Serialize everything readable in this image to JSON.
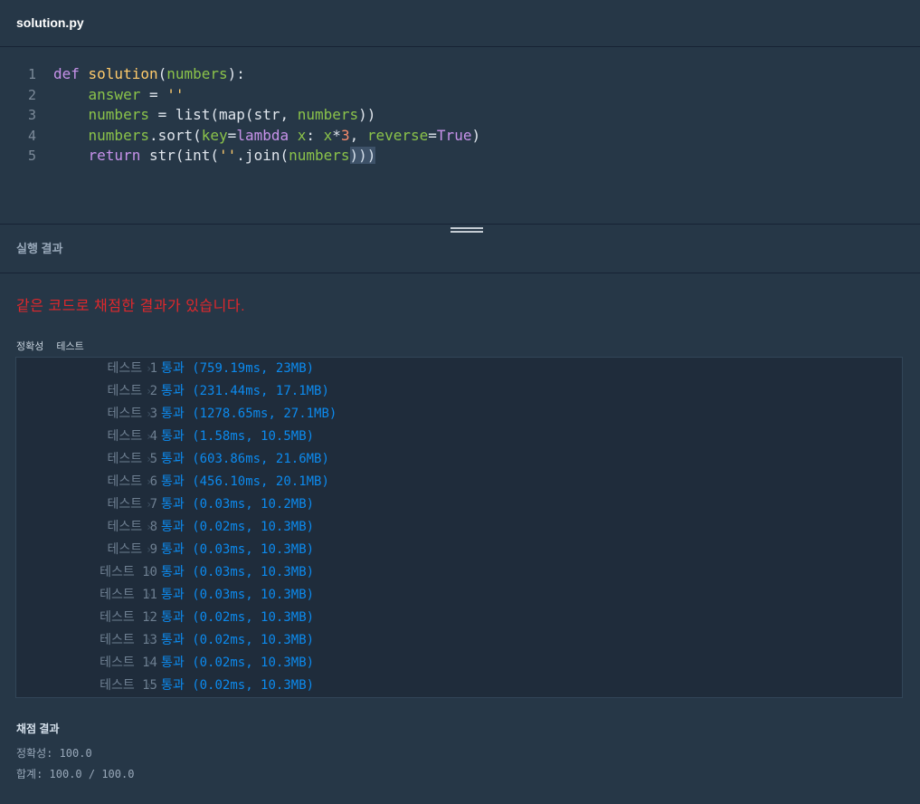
{
  "tab": {
    "title": "solution.py"
  },
  "code": [
    {
      "n": "1",
      "tokens": [
        [
          "kw",
          "def "
        ],
        [
          "fn",
          "solution"
        ],
        [
          "pl",
          "("
        ],
        [
          "pm",
          "numbers"
        ],
        [
          "pl",
          "):"
        ]
      ]
    },
    {
      "n": "2",
      "tokens": [
        [
          "pl",
          "    "
        ],
        [
          "vr",
          "answer"
        ],
        [
          "pl",
          " = "
        ],
        [
          "st",
          "''"
        ]
      ]
    },
    {
      "n": "3",
      "tokens": [
        [
          "pl",
          "    "
        ],
        [
          "vr",
          "numbers"
        ],
        [
          "pl",
          " = list(map(str, "
        ],
        [
          "vr",
          "numbers"
        ],
        [
          "pl",
          "))"
        ]
      ]
    },
    {
      "n": "4",
      "tokens": [
        [
          "pl",
          "    "
        ],
        [
          "vr",
          "numbers"
        ],
        [
          "pl",
          ".sort("
        ],
        [
          "pm",
          "key"
        ],
        [
          "pl",
          "="
        ],
        [
          "kw",
          "lambda"
        ],
        [
          "pl",
          " "
        ],
        [
          "pm",
          "x"
        ],
        [
          "pl",
          ": "
        ],
        [
          "pm",
          "x"
        ],
        [
          "pl",
          "*"
        ],
        [
          "nm",
          "3"
        ],
        [
          "pl",
          ", "
        ],
        [
          "pm",
          "reverse"
        ],
        [
          "pl",
          "="
        ],
        [
          "kw",
          "True"
        ],
        [
          "pl",
          ")"
        ]
      ]
    },
    {
      "n": "5",
      "tokens": [
        [
          "pl",
          "    "
        ],
        [
          "kw",
          "return"
        ],
        [
          "pl",
          " str(int("
        ],
        [
          "st",
          "''"
        ],
        [
          "pl",
          ".join("
        ],
        [
          "vr",
          "numbers"
        ],
        [
          "sel",
          ")))"
        ]
      ]
    }
  ],
  "run": {
    "header": "실행 결과",
    "notice": "같은 코드로 채점한 결과가 있습니다."
  },
  "tests": {
    "label_a": "정확성",
    "label_b": "테스트",
    "rows": [
      {
        "name": "테스트 1",
        "result": "통과 (759.19ms, 23MB)"
      },
      {
        "name": "테스트 2",
        "result": "통과 (231.44ms, 17.1MB)"
      },
      {
        "name": "테스트 3",
        "result": "통과 (1278.65ms, 27.1MB)"
      },
      {
        "name": "테스트 4",
        "result": "통과 (1.58ms, 10.5MB)"
      },
      {
        "name": "테스트 5",
        "result": "통과 (603.86ms, 21.6MB)"
      },
      {
        "name": "테스트 6",
        "result": "통과 (456.10ms, 20.1MB)"
      },
      {
        "name": "테스트 7",
        "result": "통과 (0.03ms, 10.2MB)"
      },
      {
        "name": "테스트 8",
        "result": "통과 (0.02ms, 10.3MB)"
      },
      {
        "name": "테스트 9",
        "result": "통과 (0.03ms, 10.3MB)"
      },
      {
        "name": "테스트 10",
        "result": "통과 (0.03ms, 10.3MB)"
      },
      {
        "name": "테스트 11",
        "result": "통과 (0.03ms, 10.3MB)"
      },
      {
        "name": "테스트 12",
        "result": "통과 (0.02ms, 10.3MB)"
      },
      {
        "name": "테스트 13",
        "result": "통과 (0.02ms, 10.3MB)"
      },
      {
        "name": "테스트 14",
        "result": "통과 (0.02ms, 10.3MB)"
      },
      {
        "name": "테스트 15",
        "result": "통과 (0.02ms, 10.3MB)"
      }
    ]
  },
  "grade": {
    "title": "채점 결과",
    "accuracy": "정확성: 100.0",
    "total": "합계: 100.0 / 100.0"
  }
}
